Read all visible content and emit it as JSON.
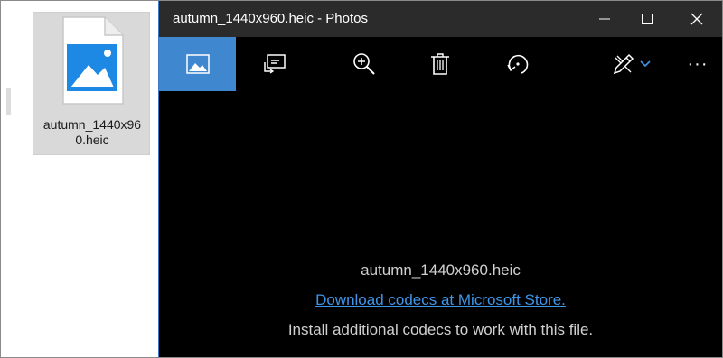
{
  "desktop": {
    "file": {
      "name": "autumn_1440x960.heic",
      "icon": "image-file-icon"
    }
  },
  "window": {
    "title": "autumn_1440x960.heic - Photos",
    "controls": [
      "minimize-icon",
      "maximize-icon",
      "close-icon"
    ]
  },
  "toolbar": {
    "items": [
      "view-photo-icon",
      "slideshow-icon",
      "zoom-in-icon",
      "delete-icon",
      "rotate-icon",
      "edit-create-icon",
      "chevron-down-icon",
      "more-icon"
    ],
    "more_label": "···",
    "accent": "#3f87cf"
  },
  "message": {
    "file_name": "autumn_1440x960.heic",
    "link_text": "Download codecs at Microsoft Store.",
    "info_text": "Install additional codecs to work with this file.",
    "link_color": "#3f95e8"
  }
}
